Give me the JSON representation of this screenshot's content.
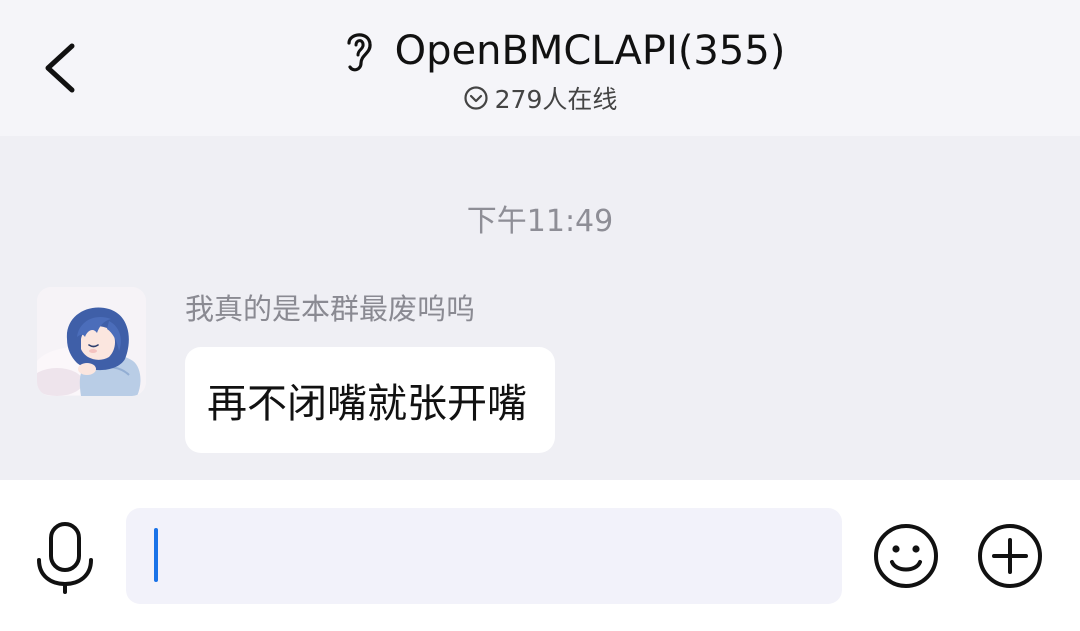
{
  "header": {
    "title": "OpenBMCLAPI(355)",
    "online_status": "279人在线",
    "back_icon": "chevron-left-icon",
    "mode_icon": "ear-icon",
    "status_icon": "chevron-down-circle-icon"
  },
  "chat": {
    "timestamp": "下午11:49",
    "messages": [
      {
        "sender": "我真的是本群最废呜呜",
        "text": "再不闭嘴就张开嘴",
        "avatar": "anime-girl-sleeping-avatar"
      }
    ]
  },
  "input_bar": {
    "value": "",
    "voice_icon": "microphone-icon",
    "emoji_icon": "smiley-icon",
    "more_icon": "plus-circle-icon",
    "caret_color": "#1a73e8"
  },
  "colors": {
    "header_bg": "#f5f5f9",
    "chat_bg": "#efeff4",
    "bubble_bg": "#ffffff",
    "input_bg": "#f2f2fa"
  }
}
